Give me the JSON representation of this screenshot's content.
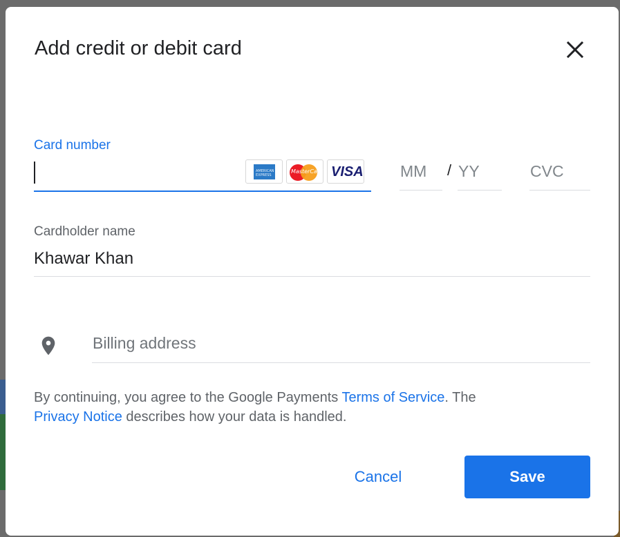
{
  "dialog": {
    "title": "Add credit or debit card",
    "close_icon": "close-icon"
  },
  "card": {
    "label": "Card number",
    "value": "",
    "logos": [
      {
        "name": "American Express",
        "icon": "amex-logo",
        "text": "AMERICAN EXPRESS"
      },
      {
        "name": "MasterCard",
        "icon": "mastercard-logo",
        "text": "MasterCard"
      },
      {
        "name": "Visa",
        "icon": "visa-logo",
        "text": "VISA"
      }
    ]
  },
  "expiry": {
    "month_placeholder": "MM",
    "separator": "/",
    "year_placeholder": "YY"
  },
  "cvc": {
    "placeholder": "CVC"
  },
  "cardholder": {
    "label": "Cardholder name",
    "value": "Khawar Khan"
  },
  "billing": {
    "icon": "location-pin-icon",
    "placeholder": "Billing address"
  },
  "legal": {
    "prefix": "By continuing, you agree to the Google Payments ",
    "terms_link": "Terms of Service",
    "middle": ". The",
    "privacy_link": "Privacy Notice",
    "suffix": " describes how your data is handled."
  },
  "actions": {
    "cancel_label": "Cancel",
    "save_label": "Save"
  },
  "colors": {
    "accent": "#1a73e8",
    "text": "#202124",
    "muted": "#5f6368"
  }
}
